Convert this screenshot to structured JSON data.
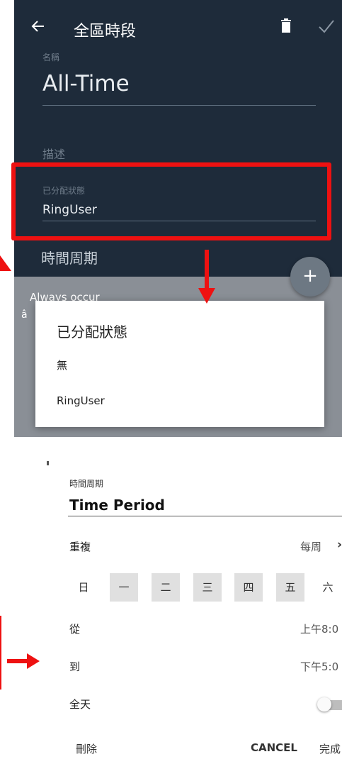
{
  "top": {
    "appbar": {
      "title": "全區時段"
    },
    "name": {
      "label": "名稱",
      "value": "All-Time"
    },
    "description": {
      "placeholder": "描述"
    },
    "assigned_status": {
      "label": "已分配狀態",
      "value": "RingUser"
    },
    "period_heading": "時間周期",
    "fab_label": "+",
    "list_peek": "Always occur",
    "list_peek2": "â",
    "dialog": {
      "title": "已分配狀態",
      "options": [
        "無",
        "RingUser"
      ]
    }
  },
  "bottom": {
    "period": {
      "label": "時間周期",
      "value": "Time Period"
    },
    "repeat": {
      "label": "重複",
      "value": "每周",
      "chevron": "›"
    },
    "days": [
      "日",
      "一",
      "二",
      "三",
      "四",
      "五",
      "六"
    ],
    "from": {
      "label": "從",
      "value": "上午8:0"
    },
    "to": {
      "label": "到",
      "value": "下午5:0"
    },
    "all_day": {
      "label": "全天",
      "on": false
    },
    "actions": {
      "delete": "刪除",
      "cancel": "CANCEL",
      "done": "完成"
    }
  },
  "colors": {
    "dark_bg": "#1e2b3a",
    "highlight": "#ee1111",
    "selected_day": "#e0e0e0"
  },
  "icons": [
    "back-arrow-icon",
    "trash-icon",
    "check-icon",
    "plus-icon",
    "chevron-right-icon",
    "toggle-switch"
  ]
}
